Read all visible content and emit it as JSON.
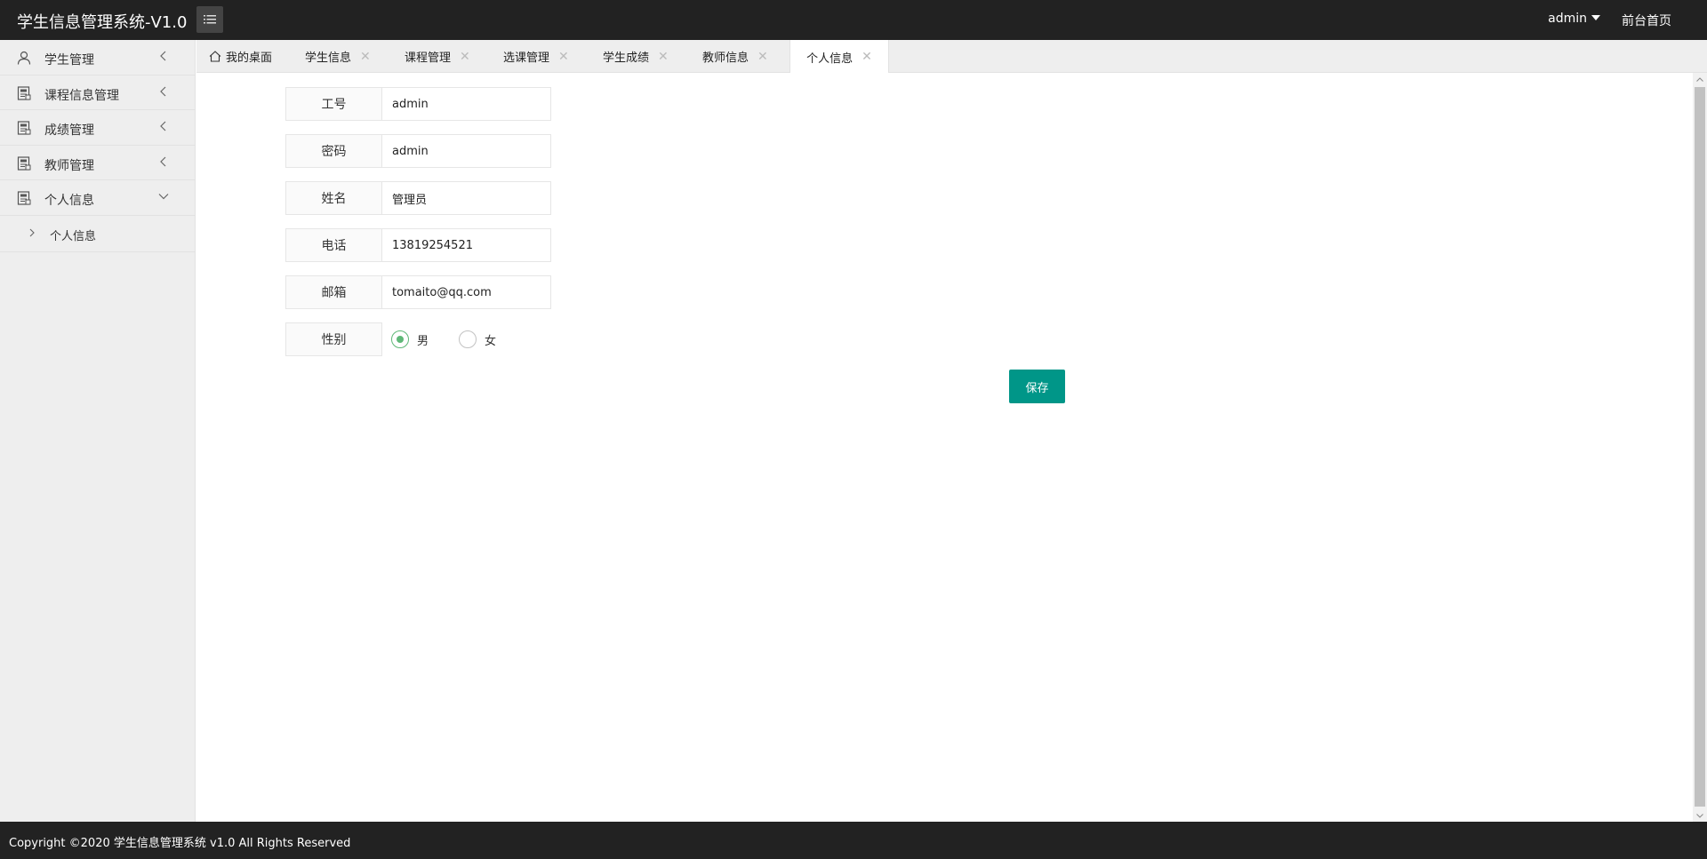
{
  "header": {
    "logo": "学生信息管理系统-V1.0",
    "menu_toggle_icon": "list-icon",
    "user": "admin",
    "front_link": "前台首页"
  },
  "sidebar": {
    "items": [
      {
        "label": "学生管理",
        "icon": "user-icon",
        "state": "collapsed"
      },
      {
        "label": "课程信息管理",
        "icon": "document-icon",
        "state": "collapsed"
      },
      {
        "label": "成绩管理",
        "icon": "document-icon",
        "state": "collapsed"
      },
      {
        "label": "教师管理",
        "icon": "document-icon",
        "state": "collapsed"
      },
      {
        "label": "个人信息",
        "icon": "document-icon",
        "state": "expanded"
      }
    ],
    "sub_items": [
      {
        "label": "个人信息"
      }
    ]
  },
  "tabs": [
    {
      "label": "我的桌面",
      "icon": "home-icon",
      "closable": false
    },
    {
      "label": "学生信息",
      "closable": true
    },
    {
      "label": "课程管理",
      "closable": true
    },
    {
      "label": "选课管理",
      "closable": true
    },
    {
      "label": "学生成绩",
      "closable": true
    },
    {
      "label": "教师信息",
      "closable": true
    },
    {
      "label": "个人信息",
      "closable": true,
      "active": true
    }
  ],
  "tab_close_glyph": "✕",
  "form": {
    "fields": [
      {
        "label": "工号",
        "value": "admin"
      },
      {
        "label": "密码",
        "value": "admin"
      },
      {
        "label": "姓名",
        "value": "管理员"
      },
      {
        "label": "电话",
        "value": "13819254521"
      },
      {
        "label": "邮箱",
        "value": "tomaito@qq.com"
      }
    ],
    "gender": {
      "label": "性别",
      "options": [
        "男",
        "女"
      ],
      "selected": "男"
    },
    "save_label": "保存"
  },
  "colors": {
    "header_bg": "#222222",
    "primary_button": "#009688",
    "radio_checked": "#5fb878",
    "sidebar_bg": "#eeeeee"
  },
  "footer": {
    "text": "Copyright ©2020 学生信息管理系统 v1.0 All Rights Reserved"
  }
}
